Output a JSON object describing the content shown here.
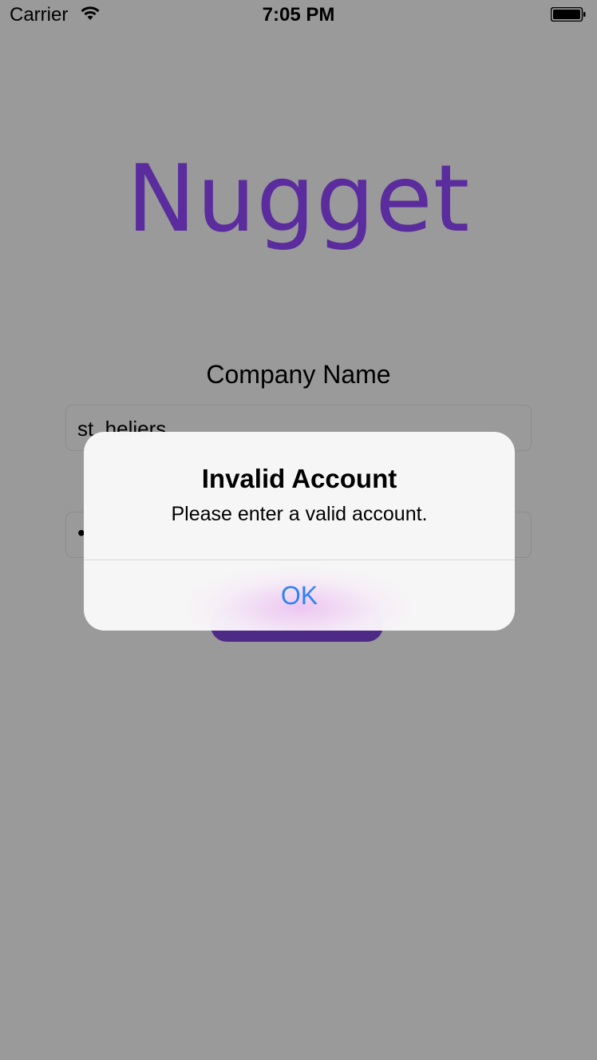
{
  "status_bar": {
    "carrier": "Carrier",
    "time": "7:05 PM",
    "wifi_icon": "wifi-icon",
    "battery_icon": "battery-icon"
  },
  "app": {
    "logo_text": "Nugget",
    "brand_color": "#5a2c9d"
  },
  "form": {
    "company_label": "Company Name",
    "company_value": "st_heliers",
    "password_value": "•",
    "login_button_color": "#4d2a85"
  },
  "alert": {
    "title": "Invalid Account",
    "message": "Please enter a valid account.",
    "ok_label": "OK",
    "ok_color": "#2d83f5"
  }
}
